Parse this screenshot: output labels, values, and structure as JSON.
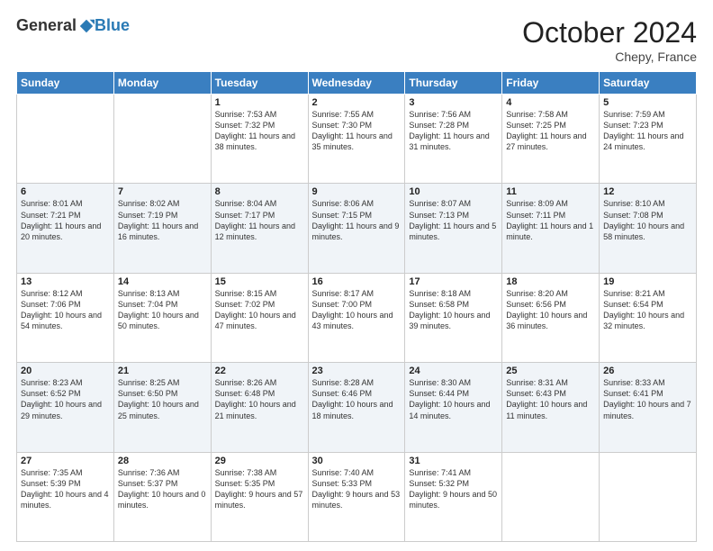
{
  "header": {
    "logo_general": "General",
    "logo_blue": "Blue",
    "month": "October 2024",
    "location": "Chepy, France"
  },
  "weekdays": [
    "Sunday",
    "Monday",
    "Tuesday",
    "Wednesday",
    "Thursday",
    "Friday",
    "Saturday"
  ],
  "weeks": [
    [
      {
        "day": "",
        "info": ""
      },
      {
        "day": "",
        "info": ""
      },
      {
        "day": "1",
        "info": "Sunrise: 7:53 AM\nSunset: 7:32 PM\nDaylight: 11 hours and 38 minutes."
      },
      {
        "day": "2",
        "info": "Sunrise: 7:55 AM\nSunset: 7:30 PM\nDaylight: 11 hours and 35 minutes."
      },
      {
        "day": "3",
        "info": "Sunrise: 7:56 AM\nSunset: 7:28 PM\nDaylight: 11 hours and 31 minutes."
      },
      {
        "day": "4",
        "info": "Sunrise: 7:58 AM\nSunset: 7:25 PM\nDaylight: 11 hours and 27 minutes."
      },
      {
        "day": "5",
        "info": "Sunrise: 7:59 AM\nSunset: 7:23 PM\nDaylight: 11 hours and 24 minutes."
      }
    ],
    [
      {
        "day": "6",
        "info": "Sunrise: 8:01 AM\nSunset: 7:21 PM\nDaylight: 11 hours and 20 minutes."
      },
      {
        "day": "7",
        "info": "Sunrise: 8:02 AM\nSunset: 7:19 PM\nDaylight: 11 hours and 16 minutes."
      },
      {
        "day": "8",
        "info": "Sunrise: 8:04 AM\nSunset: 7:17 PM\nDaylight: 11 hours and 12 minutes."
      },
      {
        "day": "9",
        "info": "Sunrise: 8:06 AM\nSunset: 7:15 PM\nDaylight: 11 hours and 9 minutes."
      },
      {
        "day": "10",
        "info": "Sunrise: 8:07 AM\nSunset: 7:13 PM\nDaylight: 11 hours and 5 minutes."
      },
      {
        "day": "11",
        "info": "Sunrise: 8:09 AM\nSunset: 7:11 PM\nDaylight: 11 hours and 1 minute."
      },
      {
        "day": "12",
        "info": "Sunrise: 8:10 AM\nSunset: 7:08 PM\nDaylight: 10 hours and 58 minutes."
      }
    ],
    [
      {
        "day": "13",
        "info": "Sunrise: 8:12 AM\nSunset: 7:06 PM\nDaylight: 10 hours and 54 minutes."
      },
      {
        "day": "14",
        "info": "Sunrise: 8:13 AM\nSunset: 7:04 PM\nDaylight: 10 hours and 50 minutes."
      },
      {
        "day": "15",
        "info": "Sunrise: 8:15 AM\nSunset: 7:02 PM\nDaylight: 10 hours and 47 minutes."
      },
      {
        "day": "16",
        "info": "Sunrise: 8:17 AM\nSunset: 7:00 PM\nDaylight: 10 hours and 43 minutes."
      },
      {
        "day": "17",
        "info": "Sunrise: 8:18 AM\nSunset: 6:58 PM\nDaylight: 10 hours and 39 minutes."
      },
      {
        "day": "18",
        "info": "Sunrise: 8:20 AM\nSunset: 6:56 PM\nDaylight: 10 hours and 36 minutes."
      },
      {
        "day": "19",
        "info": "Sunrise: 8:21 AM\nSunset: 6:54 PM\nDaylight: 10 hours and 32 minutes."
      }
    ],
    [
      {
        "day": "20",
        "info": "Sunrise: 8:23 AM\nSunset: 6:52 PM\nDaylight: 10 hours and 29 minutes."
      },
      {
        "day": "21",
        "info": "Sunrise: 8:25 AM\nSunset: 6:50 PM\nDaylight: 10 hours and 25 minutes."
      },
      {
        "day": "22",
        "info": "Sunrise: 8:26 AM\nSunset: 6:48 PM\nDaylight: 10 hours and 21 minutes."
      },
      {
        "day": "23",
        "info": "Sunrise: 8:28 AM\nSunset: 6:46 PM\nDaylight: 10 hours and 18 minutes."
      },
      {
        "day": "24",
        "info": "Sunrise: 8:30 AM\nSunset: 6:44 PM\nDaylight: 10 hours and 14 minutes."
      },
      {
        "day": "25",
        "info": "Sunrise: 8:31 AM\nSunset: 6:43 PM\nDaylight: 10 hours and 11 minutes."
      },
      {
        "day": "26",
        "info": "Sunrise: 8:33 AM\nSunset: 6:41 PM\nDaylight: 10 hours and 7 minutes."
      }
    ],
    [
      {
        "day": "27",
        "info": "Sunrise: 7:35 AM\nSunset: 5:39 PM\nDaylight: 10 hours and 4 minutes."
      },
      {
        "day": "28",
        "info": "Sunrise: 7:36 AM\nSunset: 5:37 PM\nDaylight: 10 hours and 0 minutes."
      },
      {
        "day": "29",
        "info": "Sunrise: 7:38 AM\nSunset: 5:35 PM\nDaylight: 9 hours and 57 minutes."
      },
      {
        "day": "30",
        "info": "Sunrise: 7:40 AM\nSunset: 5:33 PM\nDaylight: 9 hours and 53 minutes."
      },
      {
        "day": "31",
        "info": "Sunrise: 7:41 AM\nSunset: 5:32 PM\nDaylight: 9 hours and 50 minutes."
      },
      {
        "day": "",
        "info": ""
      },
      {
        "day": "",
        "info": ""
      }
    ]
  ]
}
